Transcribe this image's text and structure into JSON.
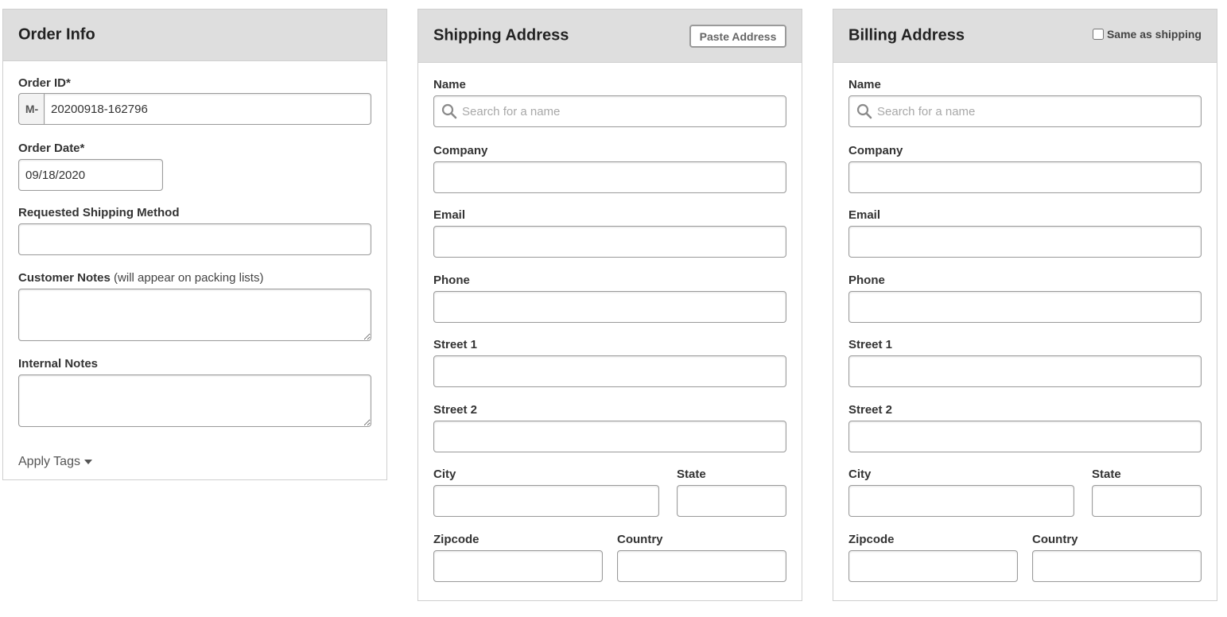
{
  "order_info": {
    "title": "Order Info",
    "order_id_label": "Order ID*",
    "order_id_prefix": "M-",
    "order_id_value": "20200918-162796",
    "order_date_label": "Order Date*",
    "order_date_value": "09/18/2020",
    "shipping_method_label": "Requested Shipping Method",
    "shipping_method_value": "",
    "customer_notes_label": "Customer Notes",
    "customer_notes_hint": "(will appear on packing lists)",
    "customer_notes_value": "",
    "internal_notes_label": "Internal Notes",
    "internal_notes_value": "",
    "apply_tags_label": "Apply Tags"
  },
  "shipping": {
    "title": "Shipping Address",
    "paste_button": "Paste Address",
    "name_label": "Name",
    "name_placeholder": "Search for a name",
    "company_label": "Company",
    "email_label": "Email",
    "phone_label": "Phone",
    "street1_label": "Street 1",
    "street2_label": "Street 2",
    "city_label": "City",
    "state_label": "State",
    "zipcode_label": "Zipcode",
    "country_label": "Country"
  },
  "billing": {
    "title": "Billing Address",
    "same_as_shipping_label": "Same as shipping",
    "same_as_shipping_checked": false,
    "name_label": "Name",
    "name_placeholder": "Search for a name",
    "company_label": "Company",
    "email_label": "Email",
    "phone_label": "Phone",
    "street1_label": "Street 1",
    "street2_label": "Street 2",
    "city_label": "City",
    "state_label": "State",
    "zipcode_label": "Zipcode",
    "country_label": "Country"
  },
  "colors": {
    "panel_header_bg": "#dedede",
    "panel_border": "#cfcfcf",
    "input_border": "#9a9a9a",
    "placeholder": "#a8a8a8"
  }
}
